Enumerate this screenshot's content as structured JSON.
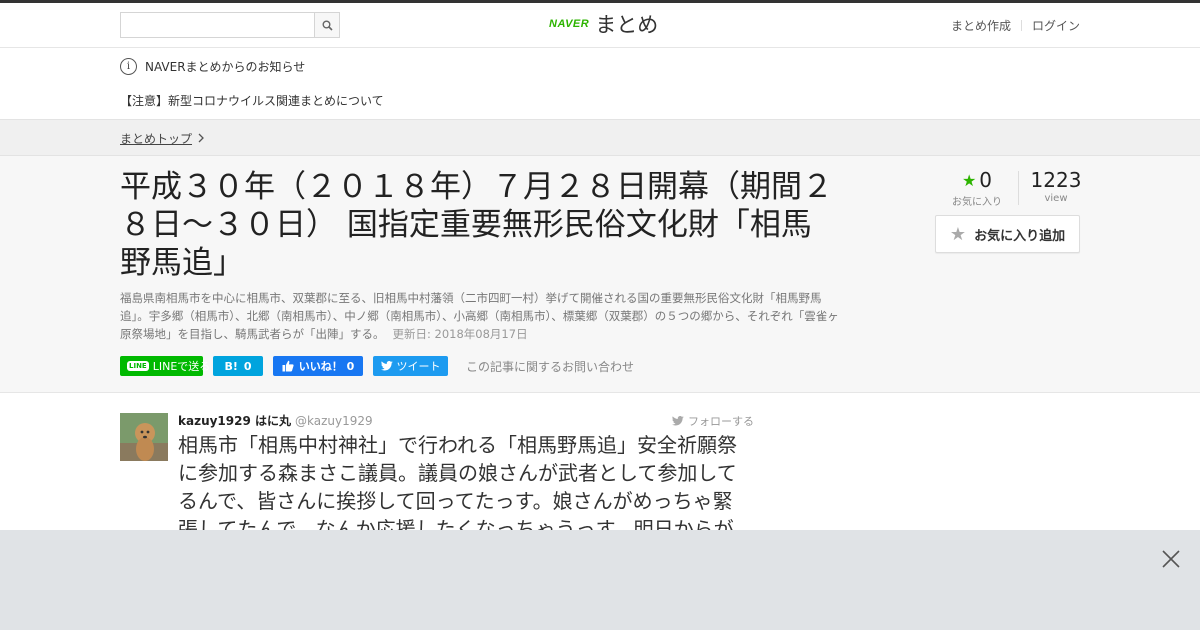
{
  "header": {
    "search": {
      "placeholder": "",
      "value": ""
    },
    "logo": {
      "brand": "NAVER",
      "product": "まとめ"
    },
    "links": {
      "create": "まとめ作成",
      "login": "ログイン"
    }
  },
  "notice": {
    "heading": "NAVERまとめからのお知らせ",
    "item": "【注意】新型コロナウイルス関連まとめについて"
  },
  "breadcrumb": {
    "home": "まとめトップ"
  },
  "article": {
    "title": "平成３０年（２０１８年）７月２８日開幕（期間２８日～３０日） 国指定重要無形民俗文化財「相馬野馬追」",
    "description": "福島県南相馬市を中心に相馬市、双葉郡に至る、旧相馬中村藩領（二市四町一村）挙げて開催される国の重要無形民俗文化財「相馬野馬追」。宇多郷（相馬市）、北郷（南相馬市）、中ノ郷（南相馬市）、小高郷（南相馬市）、標葉郷（双葉郡）の５つの郷から、それぞれ「雲雀ヶ原祭場地」を目指し、騎馬武者らが「出陣」する。",
    "updated": "更新日: 2018年08月17日",
    "stats": {
      "favorites": "0",
      "favorites_label": "お気に入り",
      "views": "1223",
      "views_label": "view"
    },
    "fav_button": "お気に入り追加",
    "share": {
      "line_badge": "LINE",
      "line": "LINEで送る",
      "hatena_icon": "B!",
      "hatena": "0",
      "facebook": "いいね！ 0",
      "twitter": "ツイート"
    },
    "inquiry": "この記事に関するお問い合わせ"
  },
  "tweet": {
    "name": "kazuy1929 はに丸",
    "handle": "@kazuy1929",
    "follow": "フォローする",
    "text": "相馬市「相馬中村神社」で行われる「相馬野馬追」安全祈願祭に参加する森まさこ議員。議員の娘さんが武者として参加してるんで、皆さんに挨拶して回ってたっす。娘さんがめっちゃ緊張してたんで、なんか応援したくなっちゃうっす。明日からが"
  },
  "colors": {
    "brand_green": "#2db400",
    "line_green": "#00b900",
    "hatena_blue": "#00a4de",
    "facebook_blue": "#1877f2",
    "twitter_blue": "#1d9bf0",
    "ad_overlay": "#e0e3e6"
  },
  "icons": [
    "search-icon",
    "info-icon",
    "chevron-right-icon",
    "star-icon",
    "twitter-bird-icon",
    "close-icon"
  ]
}
